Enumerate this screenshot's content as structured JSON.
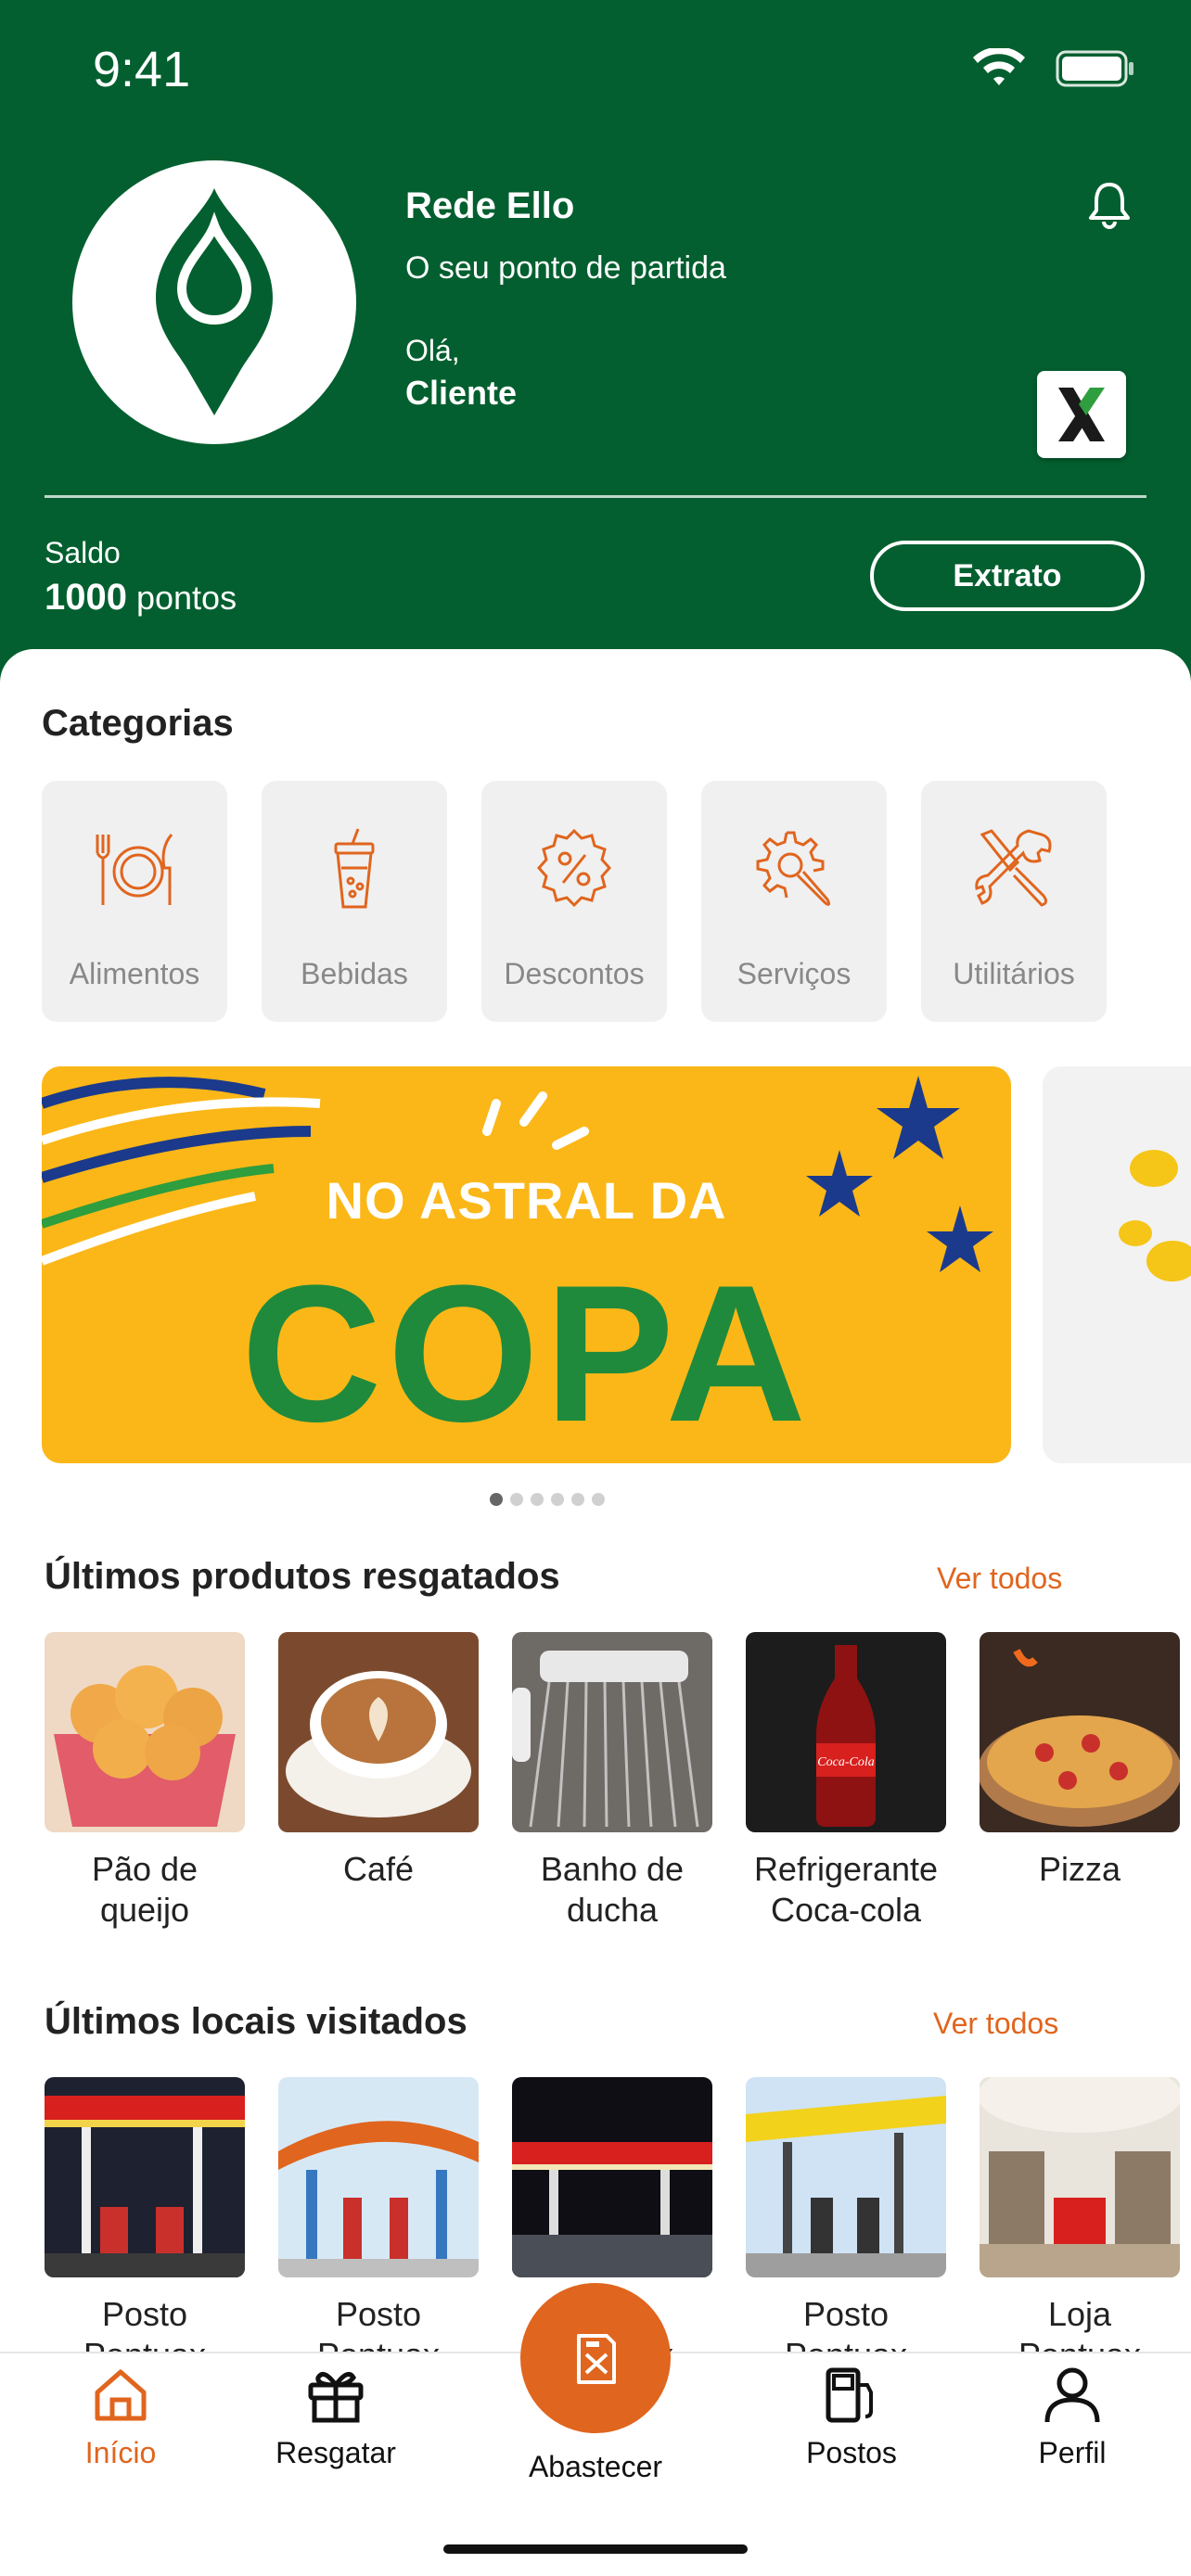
{
  "status_bar": {
    "time": "9:41"
  },
  "header": {
    "brand_title": "Rede Ello",
    "brand_subtitle": "O seu ponto de partida",
    "greeting": "Olá,",
    "user_name": "Cliente",
    "balance_label": "Saldo",
    "balance_value": "1000",
    "balance_unit": "pontos",
    "statement_button": "Extrato"
  },
  "categories": {
    "title": "Categorias",
    "items": [
      {
        "label": "Alimentos",
        "icon": "cutlery-icon"
      },
      {
        "label": "Bebidas",
        "icon": "drink-icon"
      },
      {
        "label": "Descontos",
        "icon": "discount-icon"
      },
      {
        "label": "Serviços",
        "icon": "service-gear-icon"
      },
      {
        "label": "Utilitários",
        "icon": "tools-icon"
      }
    ]
  },
  "banner": {
    "line1": "NO ASTRAL DA",
    "line2": "COPA",
    "slides": 6,
    "active_slide": 1
  },
  "redeemed": {
    "title": "Últimos produtos resgatados",
    "see_all": "Ver todos",
    "items": [
      {
        "line1": "Pão de",
        "line2": "queijo"
      },
      {
        "line1": "Café",
        "line2": ""
      },
      {
        "line1": "Banho de",
        "line2": "ducha"
      },
      {
        "line1": "Refrigerante",
        "line2": "Coca-cola"
      },
      {
        "line1": "Pizza",
        "line2": ""
      }
    ]
  },
  "visited": {
    "title": "Últimos locais visitados",
    "see_all": "Ver todos",
    "items": [
      {
        "line1": "Posto",
        "line2": "Pontuax"
      },
      {
        "line1": "Posto",
        "line2": "Pontuax"
      },
      {
        "line1": "Posto",
        "line2": "Pontuax"
      },
      {
        "line1": "Posto",
        "line2": "Pontuax"
      },
      {
        "line1": "Loja",
        "line2": "Pontuax"
      }
    ]
  },
  "nav": {
    "home": "Início",
    "redeem": "Resgatar",
    "refuel": "Abastecer",
    "stations": "Postos",
    "profile": "Perfil"
  },
  "colors": {
    "brand_green": "#035F2F",
    "accent_orange": "#E0651E",
    "banner_yellow": "#FBB718"
  }
}
